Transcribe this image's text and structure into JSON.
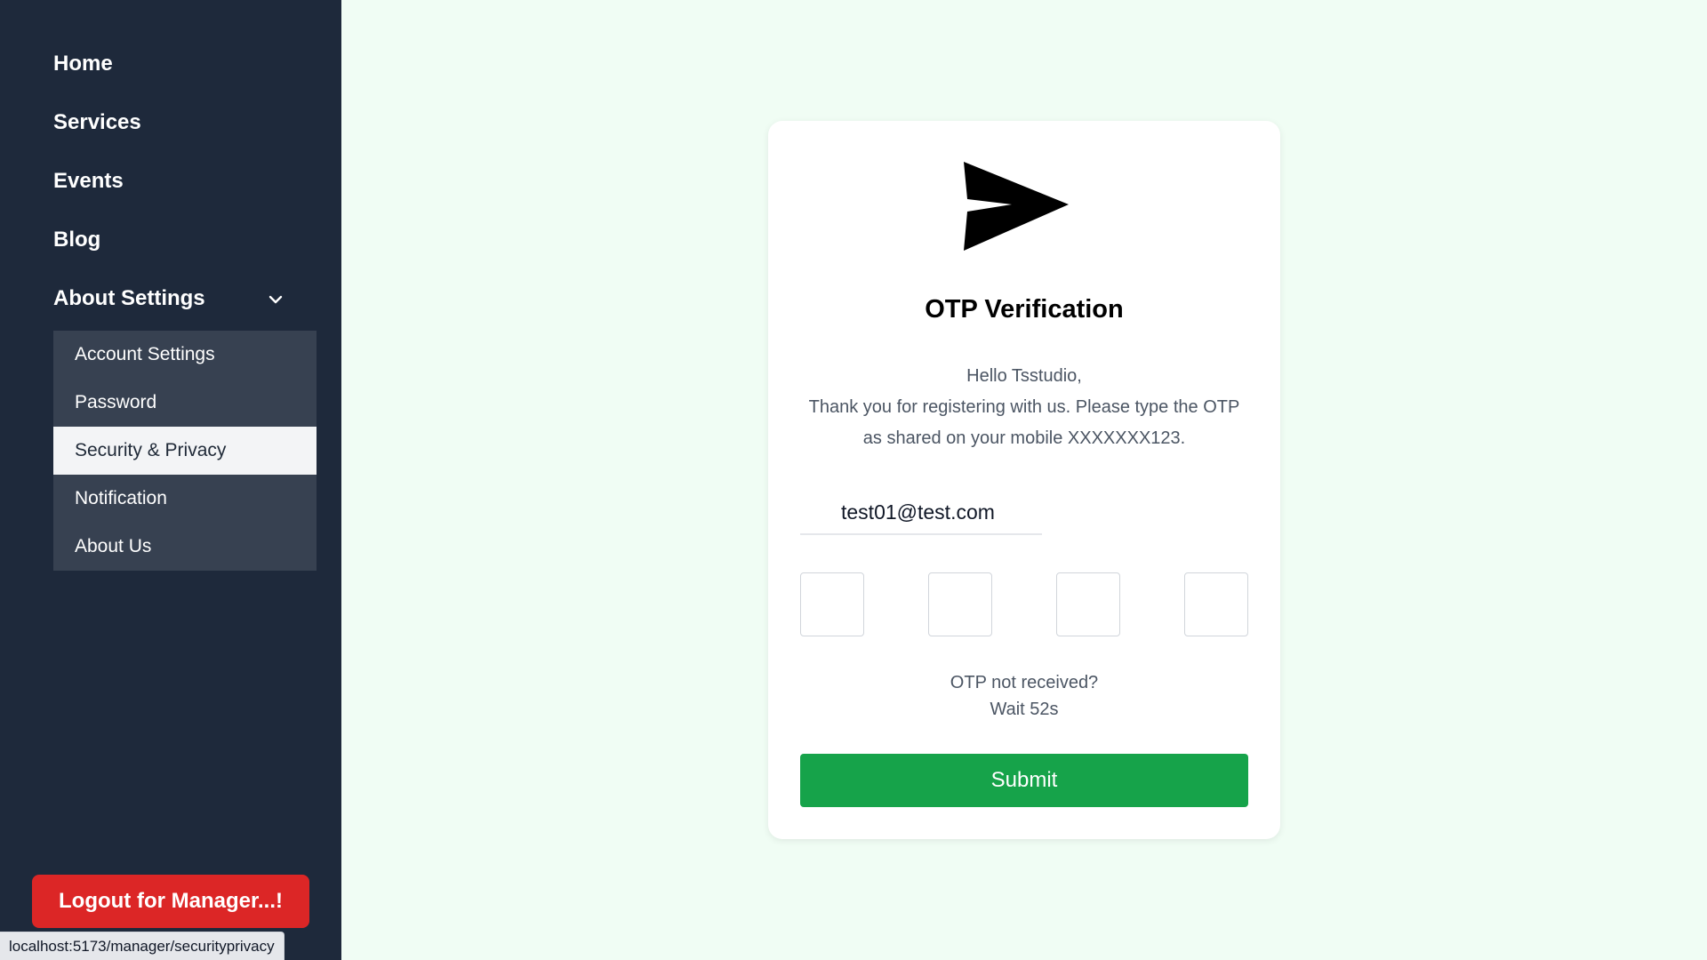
{
  "sidebar": {
    "nav": [
      "Home",
      "Services",
      "Events",
      "Blog",
      "About Settings"
    ],
    "submenu": [
      "Account Settings",
      "Password",
      "Security & Privacy",
      "Notification",
      "About Us"
    ],
    "active_submenu": "Security & Privacy",
    "logout_label": "Logout for Manager...!"
  },
  "status_url": "localhost:5173/manager/securityprivacy",
  "card": {
    "logo_icon": "send-arrow-icon",
    "title": "OTP Verification",
    "greeting": "Hello Tsstudio,",
    "message_line1": "Thank you for registering with us. Please type the OTP",
    "message_line2": "as shared on your mobile XXXXXXX123.",
    "email_value": "test01@test.com",
    "otp_digits": [
      "",
      "",
      "",
      ""
    ],
    "resend_question": "OTP not received?",
    "resend_wait": "Wait 52s",
    "submit_label": "Submit"
  },
  "colors": {
    "sidebar_bg": "#1e293b",
    "submenu_bg": "#374151",
    "page_bg": "#f0fdf4",
    "logout_red": "#dc2626",
    "submit_green": "#16a34a"
  }
}
